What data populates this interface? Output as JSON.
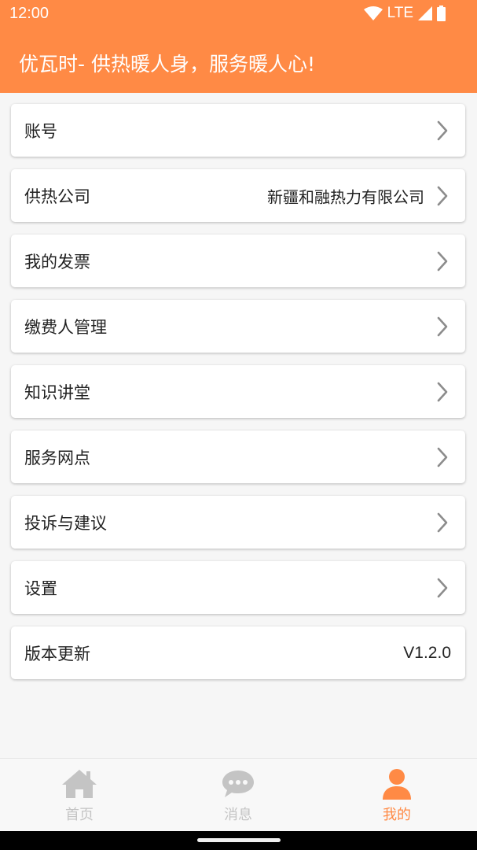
{
  "status_bar": {
    "time": "12:00",
    "network": "LTE",
    "icons": [
      "wifi-icon",
      "signal-icon",
      "battery-icon"
    ]
  },
  "header": {
    "title": "优瓦时- 供热暖人身，服务暖人心!",
    "color": "#ff8a45"
  },
  "menu": {
    "items": [
      {
        "label": "账号",
        "value": "",
        "chevron": true
      },
      {
        "label": "供热公司",
        "value": "新疆和融热力有限公司",
        "chevron": true
      },
      {
        "label": "我的发票",
        "value": "",
        "chevron": true
      },
      {
        "label": "缴费人管理",
        "value": "",
        "chevron": true
      },
      {
        "label": "知识讲堂",
        "value": "",
        "chevron": true
      },
      {
        "label": "服务网点",
        "value": "",
        "chevron": true
      },
      {
        "label": "投诉与建议",
        "value": "",
        "chevron": true
      },
      {
        "label": "设置",
        "value": "",
        "chevron": true
      },
      {
        "label": "版本更新",
        "value": "V1.2.0",
        "chevron": false
      }
    ]
  },
  "bottom_nav": {
    "tabs": [
      {
        "label": "首页",
        "icon": "home-icon",
        "active": false
      },
      {
        "label": "消息",
        "icon": "chat-bubble-icon",
        "active": false
      },
      {
        "label": "我的",
        "icon": "user-icon",
        "active": true
      }
    ],
    "active_color": "#ff8a45",
    "inactive_color": "#c4c4c4"
  }
}
